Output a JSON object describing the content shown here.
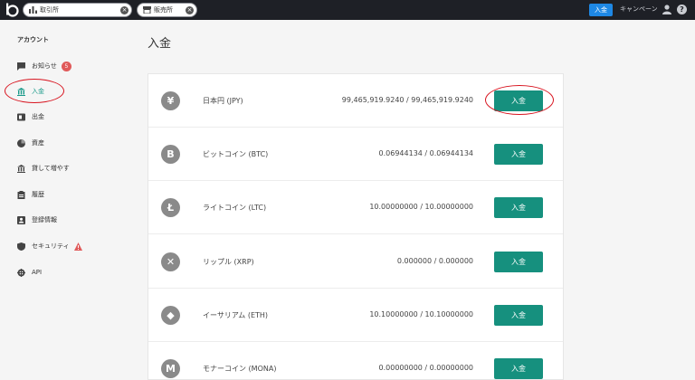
{
  "topbar": {
    "exchange_label": "取引所",
    "store_label": "販売所",
    "deposit_button": "入金",
    "campaign_link": "キャンペーン",
    "close_glyph": "×",
    "help_glyph": "?"
  },
  "sidebar": {
    "heading": "アカウント",
    "items": [
      {
        "label": "お知らせ",
        "icon": "message-icon",
        "badge": "5"
      },
      {
        "label": "入金",
        "icon": "bank-icon",
        "active": true
      },
      {
        "label": "出金",
        "icon": "withdraw-icon"
      },
      {
        "label": "資産",
        "icon": "pie-chart-icon"
      },
      {
        "label": "貸して増やす",
        "icon": "bank-icon"
      },
      {
        "label": "履歴",
        "icon": "clipboard-icon"
      },
      {
        "label": "登録情報",
        "icon": "id-card-icon"
      },
      {
        "label": "セキュリティ",
        "icon": "shield-icon",
        "warning": true
      },
      {
        "label": "API",
        "icon": "gear-icon"
      }
    ]
  },
  "main": {
    "title": "入金",
    "rows": [
      {
        "name": "日本円 (JPY)",
        "balance": "99,465,919.9240 / 99,465,919.9240",
        "button": "入金",
        "symbol": "¥"
      },
      {
        "name": "ビットコイン (BTC)",
        "balance": "0.06944134 / 0.06944134",
        "button": "入金",
        "symbol": "B"
      },
      {
        "name": "ライトコイン (LTC)",
        "balance": "10.00000000 / 10.00000000",
        "button": "入金",
        "symbol": "Ł"
      },
      {
        "name": "リップル (XRP)",
        "balance": "0.000000 / 0.000000",
        "button": "入金",
        "symbol": "✕"
      },
      {
        "name": "イーサリアム (ETH)",
        "balance": "10.10000000 / 10.10000000",
        "button": "入金",
        "symbol": "◆"
      },
      {
        "name": "モナーコイン (MONA)",
        "balance": "0.00000000 / 0.00000000",
        "button": "入金",
        "symbol": "M"
      }
    ]
  },
  "colors": {
    "accent": "#16907e",
    "topbar": "#1e2026",
    "topbutton": "#1e88e5",
    "highlight": "#d8141f"
  }
}
